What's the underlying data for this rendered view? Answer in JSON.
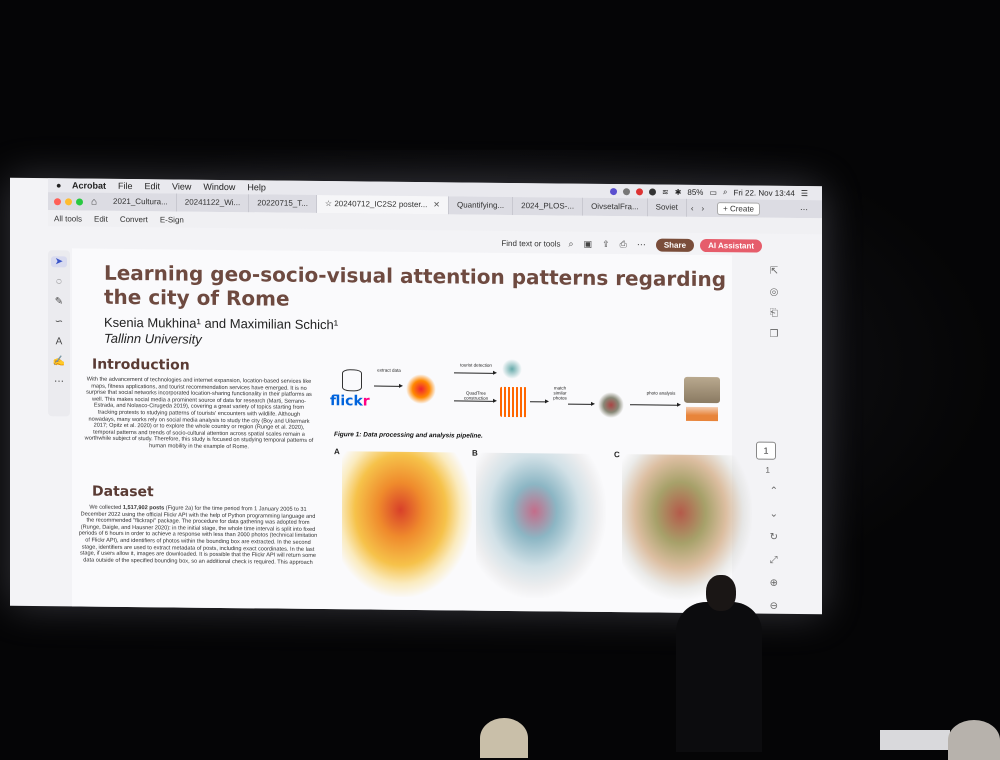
{
  "menubar": {
    "app": "Acrobat",
    "items": [
      "File",
      "Edit",
      "View",
      "Window",
      "Help"
    ],
    "battery": "85%",
    "datetime": "Fri 22. Nov  13:44"
  },
  "tabs": [
    {
      "label": "2021_Cultura..."
    },
    {
      "label": "20241122_Wi..."
    },
    {
      "label": "20220715_T..."
    },
    {
      "label": "20240712_IC2S2 poster...",
      "active": true
    },
    {
      "label": "Quantifying..."
    },
    {
      "label": "2024_PLOS-..."
    },
    {
      "label": "OivsetalFra..."
    },
    {
      "label": "Soviet"
    }
  ],
  "tab_create": "+ Create",
  "toolbar": {
    "items": [
      "All tools",
      "Edit",
      "Convert",
      "E-Sign"
    ],
    "find": "Find text or tools",
    "share": "Share",
    "ai": "AI Assistant"
  },
  "page": {
    "current": "1",
    "total": "1"
  },
  "poster": {
    "title": "Learning geo-socio-visual attention patterns regarding the city of Rome",
    "authors": "Ksenia Mukhina¹ and Maximilian Schich¹",
    "university": "Tallinn University",
    "intro_heading": "Introduction",
    "intro_text": "With the advancement of technologies and internet expansion, location-based services like maps, fitness applications, and tourist recommendation services have emerged. It is no surprise that social networks incorporated location-sharing functionality in their platforms as well. This makes social media a prominent source of data for research (Marti, Serrano-Estrada, and Nolasco-Cirugeda 2019), covering a great variety of topics starting from tracking protests to studying patterns of tourists' encounters with wildlife. Although nowadays, many works rely on social media analysis to study the city (Boy and Uitermark 2017; Opitz et al. 2020) or to explore the whole country or region (Runge et al. 2020), temporal patterns and trends of socio-cultural attention across spatial scales remain a worthwhile subject of study. Therefore, this study is focused on studying temporal patterns of human mobility in the example of Rome.",
    "dataset_heading": "Dataset",
    "dataset_text_pre": "We collected ",
    "dataset_posts": "1,517,902 posts",
    "dataset_text_post": " (Figure 2a) for the time period from 1 January 2005 to 31 December 2022 using the official Flickr API with the help of Python programming language and the recommended \"flickrapi\" package. The procedure for data gathering was adopted from (Runge, Daigle, and Hausner 2020): in the initial stage, the whole time interval is split into fixed periods of 6 hours in order to achieve a response with less than 2000 photos (technical limitation of Flickr API), and identifiers of photos within the bounding box are extracted. In the second stage, identifiers are used to extract metadata of posts, including exact coordinates. In the last stage, if users allow it, images are downloaded. It is possible that the Flickr API will return some data outside of the specified bounding box, so an additional check is required. This approach",
    "flickr_a": "flick",
    "flickr_b": "r",
    "pipe_extract": "extract data",
    "pipe_tourist": "tourist detection",
    "pipe_quadtree": "QuadTree construction",
    "pipe_match": "match similar photos",
    "pipe_photo": "photo analysis",
    "fig1_caption": "Figure 1: Data processing and analysis pipeline.",
    "map_labels": [
      "A",
      "B",
      "C"
    ]
  },
  "colors": {
    "title": "#6e4a40",
    "share_button": "#7a4d3a",
    "ai_button": "#e65d6b",
    "flickr_blue": "#0063dc",
    "flickr_pink": "#ff0084"
  }
}
